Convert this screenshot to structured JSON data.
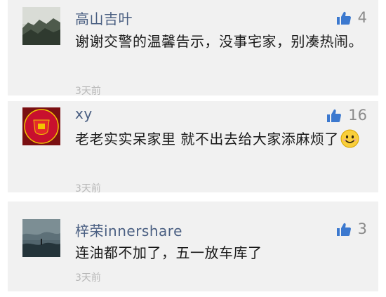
{
  "colors": {
    "card_bg": "#f1f1f1",
    "username": "#4a5f82",
    "like_icon": "#3c79cf",
    "muted": "#8a8a8a"
  },
  "comments": [
    {
      "username": "高山吉叶",
      "likes": "4",
      "content": "谢谢交警的温馨告示，没事宅家，别凑热闹。",
      "time": "3天前",
      "avatar": "landscape-photo"
    },
    {
      "username": "xy",
      "likes": "16",
      "content": "老老实实呆家里  就不出去给大家添麻烦了",
      "time": "3天前",
      "avatar": "club-crest",
      "emoji": "smiling-face-emoji"
    },
    {
      "username": "梓荣innershare",
      "likes": "3",
      "content": "连油都不加了，五一放车库了",
      "time": "3天前",
      "avatar": "stormy-sea-photo"
    }
  ]
}
